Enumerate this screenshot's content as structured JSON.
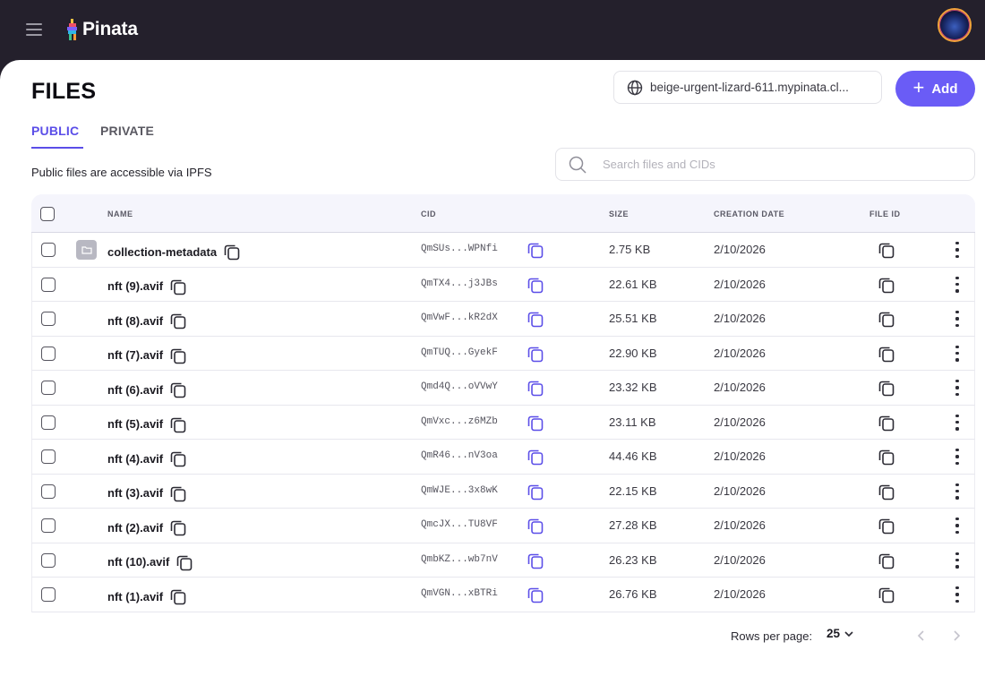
{
  "app": {
    "name": "Pinata"
  },
  "header": {
    "menu_icon": "hamburger-menu-icon",
    "avatar_icon": "user-avatar"
  },
  "page": {
    "title": "FILES",
    "gateway": "beige-urgent-lizard-611.mypinata.cl...",
    "add_label": "Add",
    "tabs": [
      {
        "label": "PUBLIC",
        "active": true
      },
      {
        "label": "PRIVATE",
        "active": false
      }
    ],
    "hint": "Public files are accessible via IPFS",
    "search_placeholder": "Search files and CIDs"
  },
  "table": {
    "columns": {
      "name": "NAME",
      "cid": "CID",
      "size": "SIZE",
      "date": "CREATION DATE",
      "file_id": "FILE ID"
    },
    "rows": [
      {
        "name": "collection-metadata",
        "is_folder": true,
        "cid": "QmSUs...WPNfi",
        "size": "2.75 KB",
        "date": "2/10/2026"
      },
      {
        "name": "nft (9).avif",
        "is_folder": false,
        "cid": "QmTX4...j3JBs",
        "size": "22.61 KB",
        "date": "2/10/2026"
      },
      {
        "name": "nft (8).avif",
        "is_folder": false,
        "cid": "QmVwF...kR2dX",
        "size": "25.51 KB",
        "date": "2/10/2026"
      },
      {
        "name": "nft (7).avif",
        "is_folder": false,
        "cid": "QmTUQ...GyekF",
        "size": "22.90 KB",
        "date": "2/10/2026"
      },
      {
        "name": "nft (6).avif",
        "is_folder": false,
        "cid": "Qmd4Q...oVVwY",
        "size": "23.32 KB",
        "date": "2/10/2026"
      },
      {
        "name": "nft (5).avif",
        "is_folder": false,
        "cid": "QmVxc...z6MZb",
        "size": "23.11 KB",
        "date": "2/10/2026"
      },
      {
        "name": "nft (4).avif",
        "is_folder": false,
        "cid": "QmR46...nV3oa",
        "size": "44.46 KB",
        "date": "2/10/2026"
      },
      {
        "name": "nft (3).avif",
        "is_folder": false,
        "cid": "QmWJE...3x8wK",
        "size": "22.15 KB",
        "date": "2/10/2026"
      },
      {
        "name": "nft (2).avif",
        "is_folder": false,
        "cid": "QmcJX...TU8VF",
        "size": "27.28 KB",
        "date": "2/10/2026"
      },
      {
        "name": "nft (10).avif",
        "is_folder": false,
        "cid": "QmbKZ...wb7nV",
        "size": "26.23 KB",
        "date": "2/10/2026"
      },
      {
        "name": "nft (1).avif",
        "is_folder": false,
        "cid": "QmVGN...xBTRi",
        "size": "26.76 KB",
        "date": "2/10/2026"
      }
    ]
  },
  "footer": {
    "rows_per_page_label": "Rows per page:",
    "rows_per_page_value": "25"
  },
  "colors": {
    "accent": "#6a5cf6",
    "topbar": "#24202c",
    "copy_icon_accent": "#5b4ee8"
  }
}
